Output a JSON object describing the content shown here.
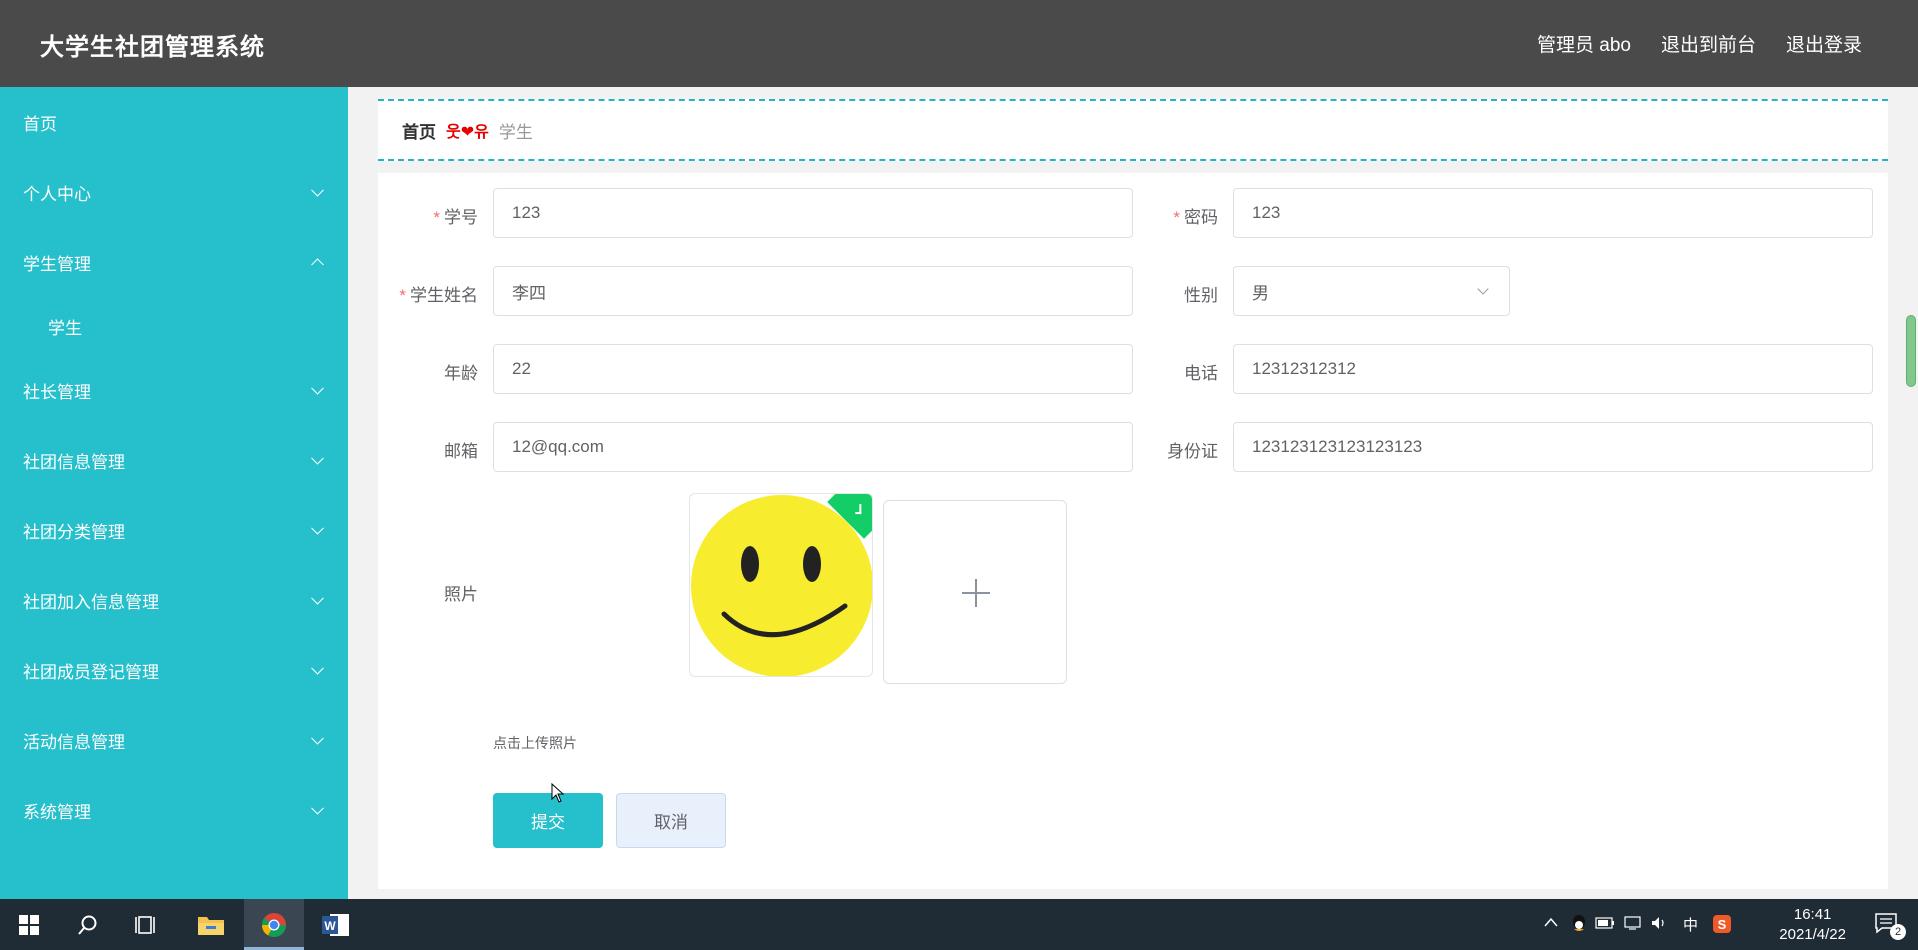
{
  "header": {
    "app_title": "大学生社团管理系统",
    "admin_label": "管理员 abo",
    "to_frontend": "退出到前台",
    "logout": "退出登录"
  },
  "sidebar": {
    "items": [
      {
        "label": "首页"
      },
      {
        "label": "个人中心"
      },
      {
        "label": "学生管理"
      },
      {
        "label": "学生"
      },
      {
        "label": "社长管理"
      },
      {
        "label": "社团信息管理"
      },
      {
        "label": "社团分类管理"
      },
      {
        "label": "社团加入信息管理"
      },
      {
        "label": "社团成员登记管理"
      },
      {
        "label": "活动信息管理"
      },
      {
        "label": "系统管理"
      }
    ]
  },
  "breadcrumb": {
    "home": "首页",
    "separator": "웃❤유",
    "current": "学生"
  },
  "form": {
    "student_id": {
      "label": "学号",
      "value": "123"
    },
    "password": {
      "label": "密码",
      "value": "123"
    },
    "student_name": {
      "label": "学生姓名",
      "value": "李四"
    },
    "gender": {
      "label": "性别",
      "value": "男"
    },
    "age": {
      "label": "年龄",
      "value": "22"
    },
    "phone": {
      "label": "电话",
      "value": "12312312312"
    },
    "email": {
      "label": "邮箱",
      "value": "12@qq.com"
    },
    "id_card": {
      "label": "身份证",
      "value": "123123123123123123"
    },
    "photo": {
      "label": "照片",
      "tip": "点击上传照片"
    },
    "required_mark": "*",
    "submit": "提交",
    "cancel": "取消"
  },
  "taskbar": {
    "ime": "中",
    "time": "16:41",
    "date": "2021/4/22",
    "notification_count": "2"
  },
  "colors": {
    "sidebar": "#26c0cc",
    "header": "#4a4a4a",
    "primary": "#26c0cc",
    "required": "#f56c6c"
  }
}
